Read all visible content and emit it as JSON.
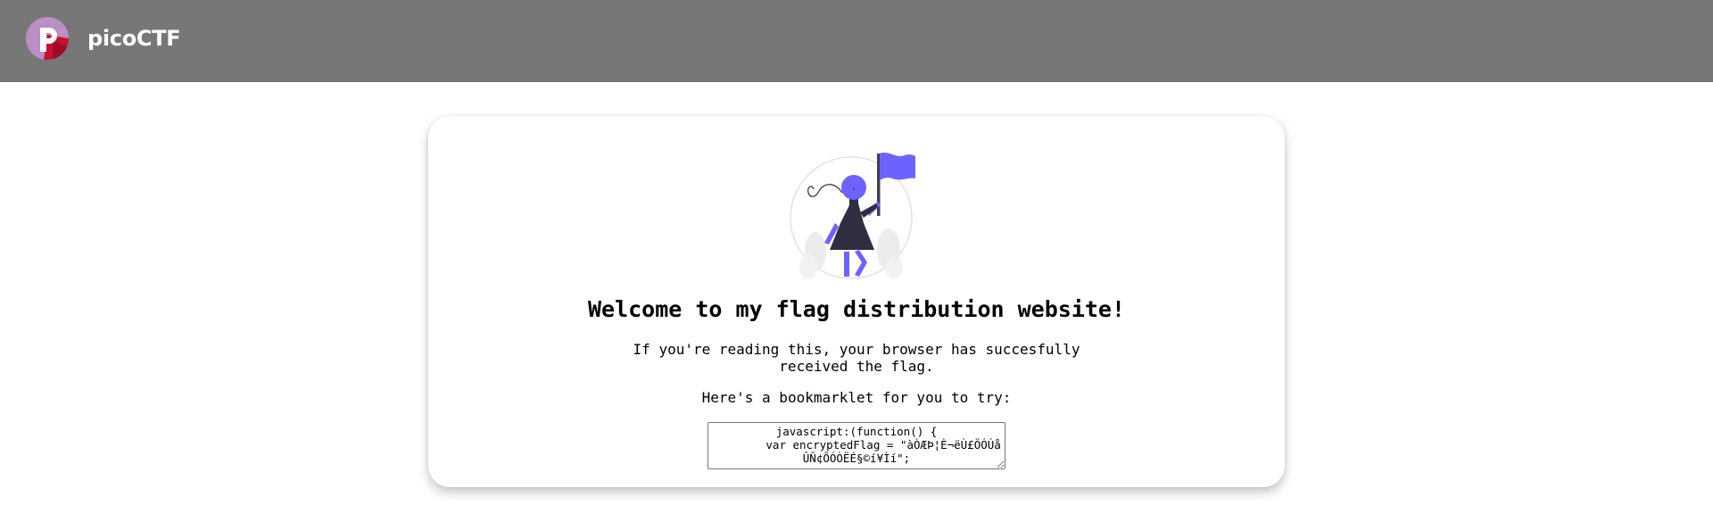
{
  "header": {
    "brand_name": "picoCTF",
    "logo_icon": "picoctf-logo-icon",
    "background": "#777777"
  },
  "main": {
    "illustration": "flag-girl-illustration",
    "title": "Welcome to my flag distribution website!",
    "description": "If you're reading this, your browser has succesfully received the flag.",
    "bookmarklet_label": "Here's a bookmarklet for you to try:",
    "bookmarklet_code": "javascript:(function() {\n        var encryptedFlag = \"àÒÆÞ¦È¬ëÙ£ÖÓÚåÛÑ¢ÕÓÒËÉ§©í¥Ìí\";"
  },
  "colors": {
    "accent": "#6C63FF",
    "dark": "#2F2E41",
    "logo_red": "#C8102E"
  }
}
